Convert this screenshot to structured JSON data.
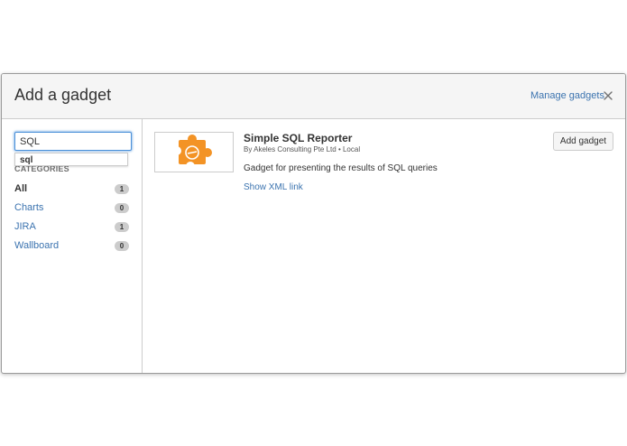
{
  "dialog": {
    "title": "Add a gadget",
    "manage_link": "Manage gadgets"
  },
  "search": {
    "value": "SQL",
    "suggestion": "sql"
  },
  "categories": {
    "heading": "CATEGORIES",
    "items": [
      {
        "label": "All",
        "count": "1",
        "active": true
      },
      {
        "label": "Charts",
        "count": "0",
        "active": false
      },
      {
        "label": "JIRA",
        "count": "1",
        "active": false
      },
      {
        "label": "Wallboard",
        "count": "0",
        "active": false
      }
    ]
  },
  "gadget": {
    "name": "Simple SQL Reporter",
    "meta": "By Akeles Consulting Pte Ltd • Local",
    "description": "Gadget for presenting the results of SQL queries",
    "xml_link": "Show XML link",
    "add_label": "Add gadget",
    "logo_color": "#f39325"
  },
  "colors": {
    "link": "#3b73af",
    "header_bg": "#f5f5f5",
    "badge_bg": "#cccccc"
  }
}
